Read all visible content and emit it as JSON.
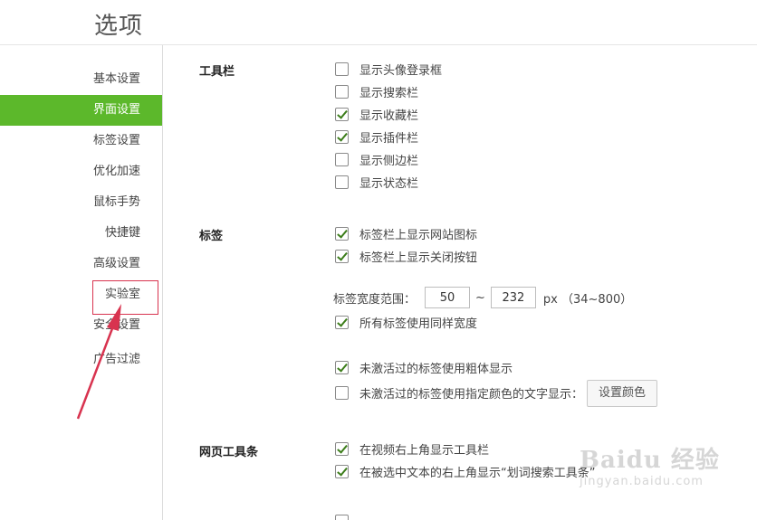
{
  "window": {
    "title": "选项"
  },
  "sidebar": {
    "items": [
      {
        "label": "基本设置"
      },
      {
        "label": "界面设置"
      },
      {
        "label": "标签设置"
      },
      {
        "label": "优化加速"
      },
      {
        "label": "鼠标手势"
      },
      {
        "label": "快捷键"
      },
      {
        "label": "高级设置"
      },
      {
        "label": "实验室"
      },
      {
        "label": "安全设置"
      },
      {
        "label": "广告过滤"
      }
    ],
    "active": "界面设置"
  },
  "sections": {
    "toolbar": {
      "label": "工具栏",
      "options": [
        {
          "label": "显示头像登录框",
          "checked": false
        },
        {
          "label": "显示搜索栏",
          "checked": false
        },
        {
          "label": "显示收藏栏",
          "checked": true
        },
        {
          "label": "显示插件栏",
          "checked": true
        },
        {
          "label": "显示侧边栏",
          "checked": false
        },
        {
          "label": "显示状态栏",
          "checked": false
        }
      ]
    },
    "tabs": {
      "label": "标签",
      "options": [
        {
          "label": "标签栏上显示网站图标",
          "checked": true
        },
        {
          "label": "标签栏上显示关闭按钮",
          "checked": true
        }
      ],
      "width_range": {
        "label": "标签宽度范围：",
        "min": "50",
        "separator": "~",
        "max": "232",
        "unit": "px （34~800）"
      },
      "same_width": {
        "label": "所有标签使用同样宽度",
        "checked": true
      },
      "inactive_bold": {
        "label": "未激活过的标签使用粗体显示",
        "checked": true
      },
      "inactive_color": {
        "label": "未激活过的标签使用指定颜色的文字显示：",
        "checked": false
      },
      "color_button": "设置颜色"
    },
    "web_toolbar": {
      "label": "网页工具条",
      "options": [
        {
          "label": "在视频右上角显示工具栏",
          "checked": true
        },
        {
          "label": "在被选中文本的右上角显示“划词搜索工具条”",
          "checked": true
        }
      ]
    }
  },
  "annotation": {
    "arrow_color": "#d8334f"
  },
  "watermark": {
    "main": "Baidu 经验",
    "sub": "jingyan.baidu.com"
  },
  "colors": {
    "accent": "#5cb82b",
    "check": "#3c7d1a"
  }
}
